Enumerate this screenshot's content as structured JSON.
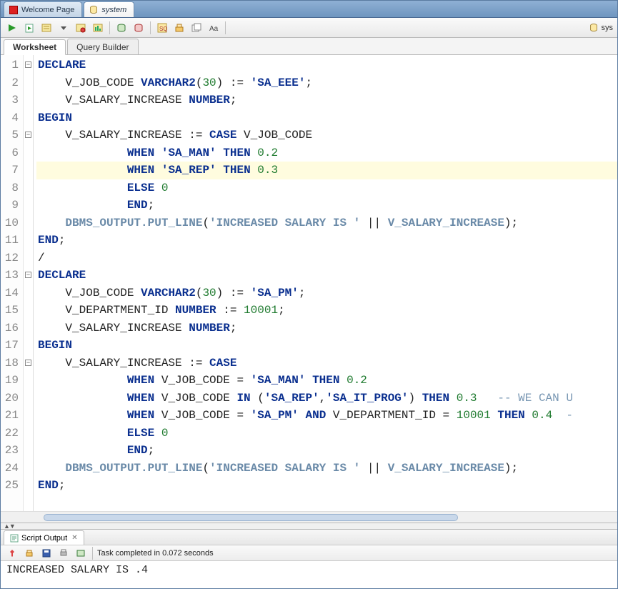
{
  "tabs": {
    "welcome": "Welcome Page",
    "system": "system"
  },
  "subtabs": {
    "worksheet": "Worksheet",
    "query_builder": "Query Builder"
  },
  "toolbar": {
    "run": "run-icon",
    "run_script": "run-script-icon",
    "explain": "explain-plan-icon",
    "autotrace": "autotrace-icon",
    "commit": "commit-icon",
    "rollback": "rollback-icon",
    "clear": "clear-icon",
    "sql_history": "sql-history-icon",
    "to_upper": "to-upper-icon",
    "right_label": "sys"
  },
  "code": {
    "lines": [
      {
        "n": 1,
        "fold": true,
        "html": "<span class='kw'>DECLARE</span>"
      },
      {
        "n": 2,
        "html": "    V_JOB_CODE <span class='ty'>VARCHAR2</span>(<span class='num'>30</span>) := <span class='str'>'SA_EEE'</span>;"
      },
      {
        "n": 3,
        "html": "    V_SALARY_INCREASE <span class='ty'>NUMBER</span>;"
      },
      {
        "n": 4,
        "html": "<span class='kw'>BEGIN</span>"
      },
      {
        "n": 5,
        "fold": true,
        "html": "    V_SALARY_INCREASE := <span class='kw'>CASE</span> V_JOB_CODE"
      },
      {
        "n": 6,
        "html": "             <span class='kw'>WHEN</span> <span class='str'>'SA_MAN'</span> <span class='kw'>THEN</span> <span class='num'>0.2</span>"
      },
      {
        "n": 7,
        "hl": true,
        "html": "             <span class='kw'>WHEN</span> <span class='str'>'SA_REP'</span> <span class='kw'>THEN</span> <span class='num'>0.3</span>"
      },
      {
        "n": 8,
        "html": "             <span class='kw'>ELSE</span> <span class='num'>0</span>"
      },
      {
        "n": 9,
        "html": "             <span class='kw'>END</span>;"
      },
      {
        "n": 10,
        "html": "    <span class='fn'>DBMS_OUTPUT.PUT_LINE</span>(<span class='fn'>'INCREASED SALARY IS '</span> || <span class='fn'>V_SALARY_INCREASE</span>);"
      },
      {
        "n": 11,
        "html": "<span class='kw'>END</span>;"
      },
      {
        "n": 12,
        "html": "/"
      },
      {
        "n": 13,
        "fold": true,
        "html": "<span class='kw'>DECLARE</span>"
      },
      {
        "n": 14,
        "html": "    V_JOB_CODE <span class='ty'>VARCHAR2</span>(<span class='num'>30</span>) := <span class='str'>'SA_PM'</span>;"
      },
      {
        "n": 15,
        "html": "    V_DEPARTMENT_ID <span class='ty'>NUMBER</span> := <span class='num'>10001</span>;"
      },
      {
        "n": 16,
        "html": "    V_SALARY_INCREASE <span class='ty'>NUMBER</span>;"
      },
      {
        "n": 17,
        "html": "<span class='kw'>BEGIN</span>"
      },
      {
        "n": 18,
        "fold": true,
        "html": "    V_SALARY_INCREASE := <span class='kw'>CASE</span>"
      },
      {
        "n": 19,
        "html": "             <span class='kw'>WHEN</span> V_JOB_CODE = <span class='str'>'SA_MAN'</span> <span class='kw'>THEN</span> <span class='num'>0.2</span>"
      },
      {
        "n": 20,
        "html": "             <span class='kw'>WHEN</span> V_JOB_CODE <span class='kw'>IN</span> (<span class='str'>'SA_REP'</span>,<span class='str'>'SA_IT_PROG'</span>) <span class='kw'>THEN</span> <span class='num'>0.3</span>   <span class='cmt'>-- WE CAN U</span>"
      },
      {
        "n": 21,
        "html": "             <span class='kw'>WHEN</span> V_JOB_CODE = <span class='str'>'SA_PM'</span> <span class='kw'>AND</span> V_DEPARTMENT_ID = <span class='num'>10001</span> <span class='kw'>THEN</span> <span class='num'>0.4</span>  <span class='cmt'>-</span>"
      },
      {
        "n": 22,
        "html": "             <span class='kw'>ELSE</span> <span class='num'>0</span>"
      },
      {
        "n": 23,
        "html": "             <span class='kw'>END</span>;"
      },
      {
        "n": 24,
        "html": "    <span class='fn'>DBMS_OUTPUT.PUT_LINE</span>(<span class='fn'>'INCREASED SALARY IS '</span> || <span class='fn'>V_SALARY_INCREASE</span>);"
      },
      {
        "n": 25,
        "html": "<span class='kw'>END</span>;"
      }
    ]
  },
  "output": {
    "tab_label": "Script Output",
    "status": "Task completed in 0.072 seconds",
    "body": "INCREASED SALARY IS .4"
  }
}
